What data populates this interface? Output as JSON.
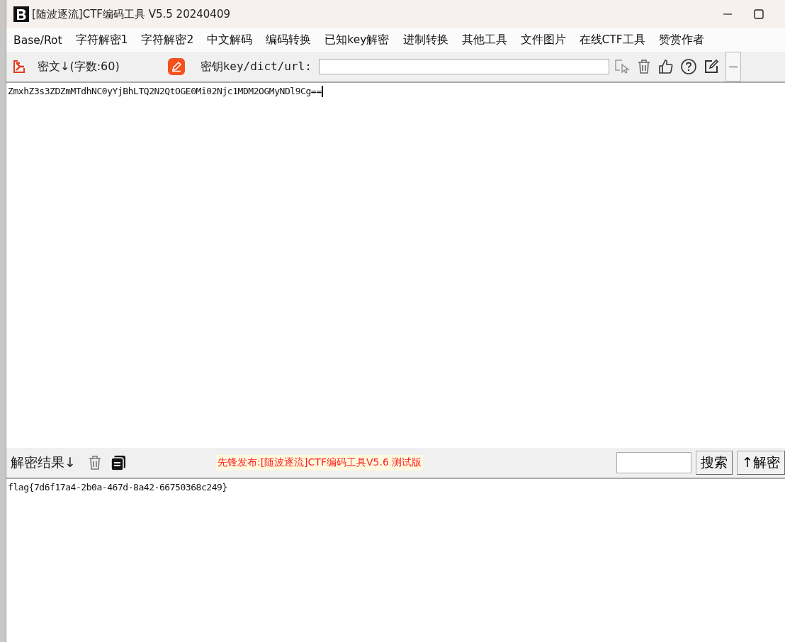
{
  "window": {
    "title": "[随波逐流]CTF编码工具 V5.5 20240409"
  },
  "menu": [
    "Base/Rot",
    "字符解密1",
    "字符解密2",
    "中文解码",
    "编码转换",
    "已知key解密",
    "进制转换",
    "其他工具",
    "文件图片",
    "在线CTF工具",
    "赞赏作者"
  ],
  "toolbar": {
    "ciphertext_label": "密文↓(字数:60)",
    "key_label": "密钥key/dict/url:"
  },
  "ciphertext": "ZmxhZ3s3ZDZmMTdhNC0yYjBhLTQ2N2QtOGE0Mi02Njc1MDM2OGMyNDl9Cg==",
  "result_bar": {
    "label": "解密结果↓",
    "notice": "先锋发布:[随波逐流]CTF编码工具V5.6 测试版",
    "search_button": "搜索",
    "decrypt_button": "↑解密"
  },
  "result": "flag{7d6f17a4-2b0a-467d-8a42-66750368c249}"
}
